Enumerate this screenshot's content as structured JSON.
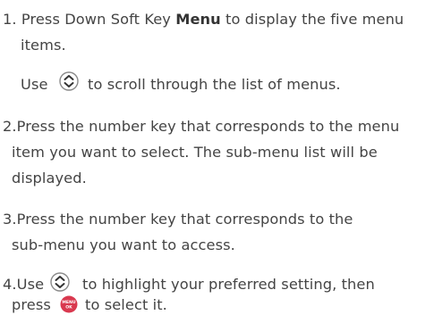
{
  "steps": [
    {
      "prefix": "1. Press Down Soft Key ",
      "bold": "Menu",
      "suffix": " to display the five menu",
      "cont": "items.",
      "use_pre": "Use",
      "use_post": "to scroll through the list of menus."
    },
    {
      "line1": "2.Press the number key that corresponds to the menu",
      "line2": "item you want to select. The sub-menu list will be",
      "line3": "displayed."
    },
    {
      "line1": "3.Press the number key that corresponds to the",
      "line2": "sub-menu you want to access."
    },
    {
      "pre": "4.Use",
      "post": "to highlight your preferred setting, then",
      "line2_pre": "press",
      "line2_post": "to select it."
    }
  ],
  "icons": {
    "nav_key": "up-down-navigation-key-icon",
    "menu_ok_key": "menu-ok-key-icon",
    "menu_ok_label_top": "MENU",
    "menu_ok_label_bottom": "OK"
  },
  "colors": {
    "text": "#444444",
    "icon_outline": "#8a8a8a",
    "menu_key": "#d9394f"
  }
}
